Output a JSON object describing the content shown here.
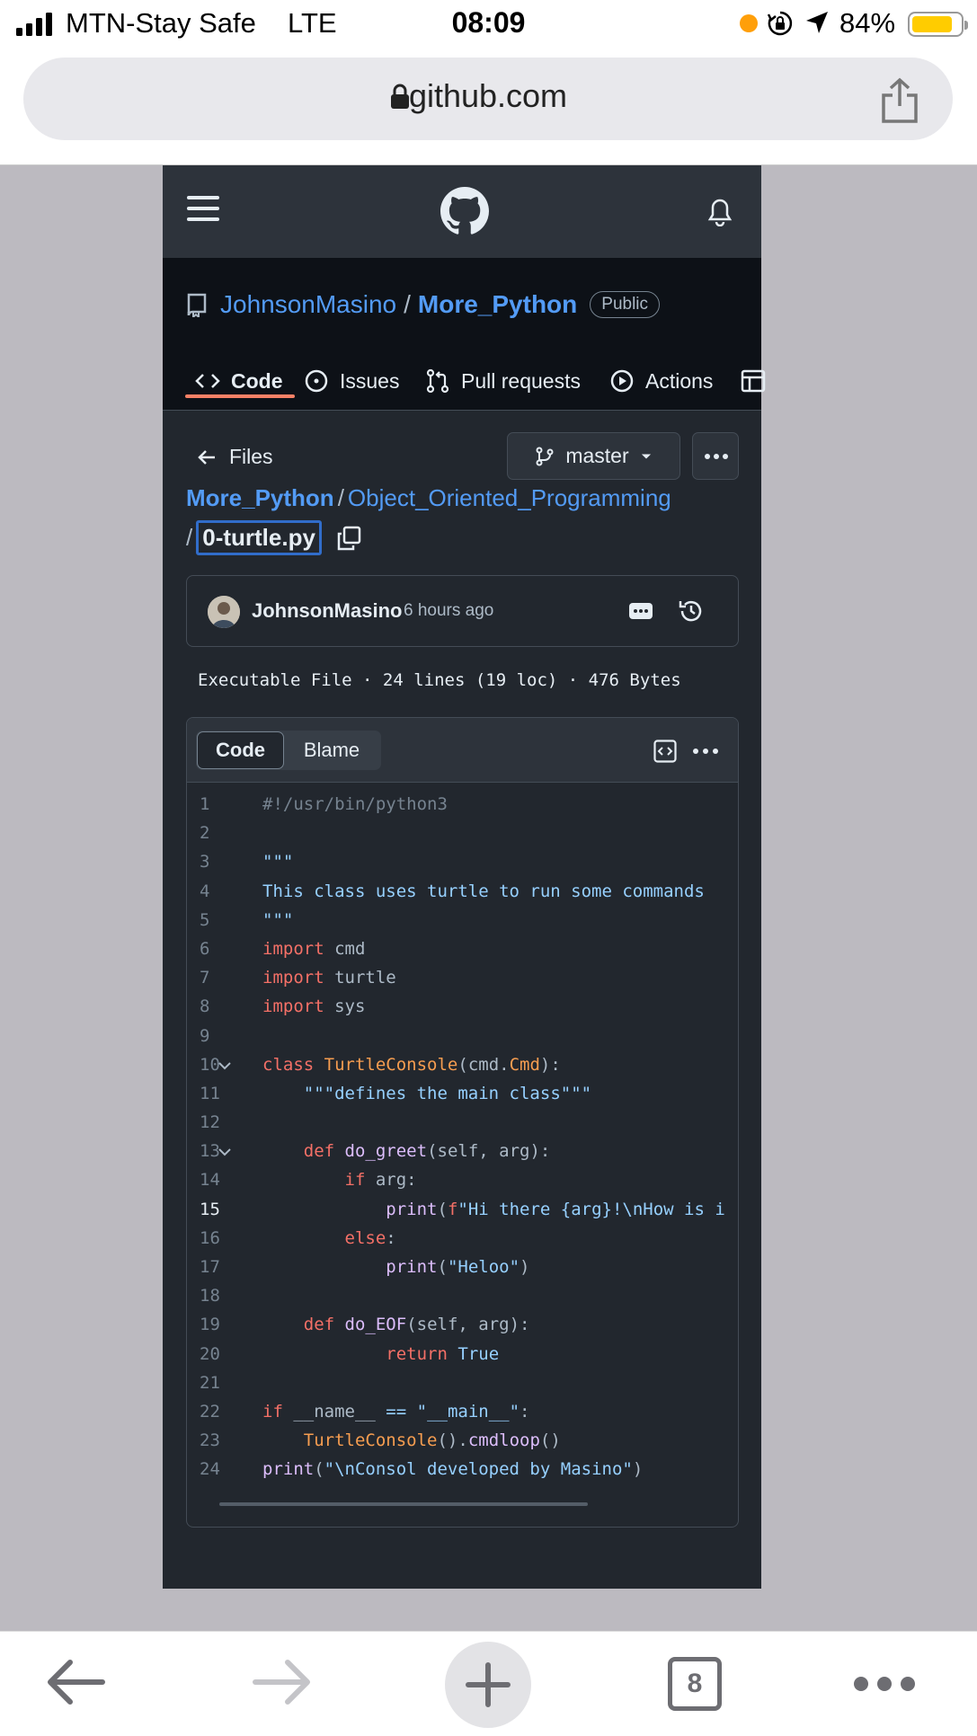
{
  "status_bar": {
    "carrier": "MTN-Stay Safe",
    "network": "LTE",
    "time": "08:09",
    "battery_percent": "84%",
    "battery_level": 0.84,
    "recording_dot_color": "#ff9f0a",
    "battery_color": "#ffcc00"
  },
  "browser": {
    "domain": "github.com",
    "tab_count": "8"
  },
  "repo": {
    "owner": "JohnsonMasino",
    "separator": "/",
    "name": "More_Python",
    "visibility": "Public"
  },
  "tabs": [
    {
      "label": "Code",
      "icon": "code-icon",
      "active": true
    },
    {
      "label": "Issues",
      "icon": "issue-opened-icon",
      "active": false
    },
    {
      "label": "Pull requests",
      "icon": "git-pull-request-icon",
      "active": false
    },
    {
      "label": "Actions",
      "icon": "play-icon",
      "active": false
    }
  ],
  "file_nav": {
    "files_label": "Files",
    "branch": "master"
  },
  "breadcrumb": {
    "repo": "More_Python",
    "separator": "/",
    "directory": "Object_Oriented_Programming",
    "file": "0-turtle.py"
  },
  "commit": {
    "author": "JohnsonMasino",
    "when": "6 hours ago"
  },
  "file_info": "Executable File · 24 lines (19 loc) · 476 Bytes",
  "code_view": {
    "code_tab": "Code",
    "blame_tab": "Blame",
    "current_line": 15,
    "lines": [
      "#!/usr/bin/python3",
      "",
      "\"\"\"",
      "This class uses turtle to run some commands",
      "\"\"\"",
      "import cmd",
      "import turtle",
      "import sys",
      "",
      "class TurtleConsole(cmd.Cmd):",
      "    \"\"\"defines the main class\"\"\"",
      "",
      "    def do_greet(self, arg):",
      "        if arg:",
      "            print(f\"Hi there {arg}!\\nHow is i",
      "        else:",
      "            print(\"Heloo\")",
      "",
      "    def do_EOF(self, arg):",
      "            return True",
      "",
      "if __name__ == \"__main__\":",
      "    TurtleConsole().cmdloop()",
      "print(\"\\nConsol developed by Masino\")"
    ]
  },
  "colors": {
    "header_bg": "#2d333b",
    "repo_header_bg": "#0d1117",
    "canvas_bg": "#22272e",
    "link": "#539bf5",
    "keyword": "#f47067",
    "string": "#96d0ff",
    "function": "#dcbdfb",
    "class_name": "#f69d50",
    "tab_underline": "#f78166"
  }
}
